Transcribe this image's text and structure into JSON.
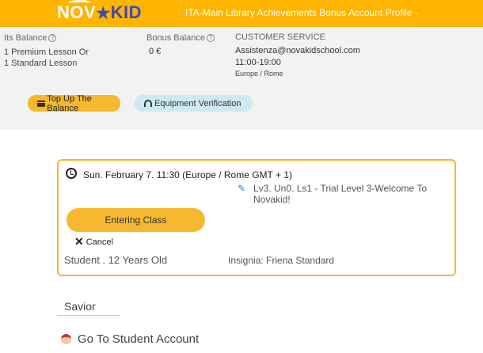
{
  "header": {
    "logo_left": "NOV",
    "logo_star": "★",
    "logo_right": "KID",
    "nav": "ITA-Main Library Achievements Bonus Account Profile -"
  },
  "balance": {
    "label": "Its Balance",
    "line1": "1 Premium Lesson Or",
    "line2": "1 Standard Lesson"
  },
  "bonus": {
    "label": "Bonus Balance",
    "value": "0 €"
  },
  "service": {
    "label": "CUSTOMER SERVICE",
    "email": "Assistenza@novakidschool.com",
    "hours": "11:00-19:00",
    "timezone": "Europe / Rome"
  },
  "buttons": {
    "topup": "Top Up The Balance",
    "equipment": "Equipment Verification"
  },
  "lesson": {
    "time": "Sun. February 7. 11:30 (Europe / Rome GMT + 1)",
    "title": "Lv3. Un0. Ls1 - Trial Level 3-Welcome To Novakid!",
    "enter": "Entering Class",
    "cancel": "Cancel",
    "student": "Student . 12 Years Old",
    "badge": "Insignia: Friena Standard"
  },
  "section": {
    "title": "Savior"
  },
  "link": {
    "go_student": "Go To Student Account"
  }
}
